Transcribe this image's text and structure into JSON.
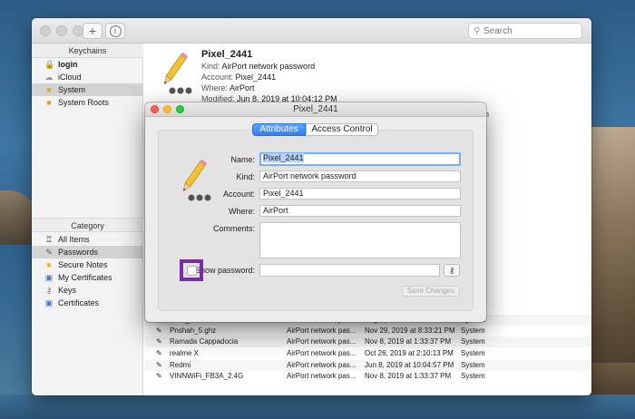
{
  "window": {
    "search_placeholder": "Search",
    "add_icon": "plus-icon",
    "info_icon": "info-icon"
  },
  "sidebar": {
    "keychains_header": "Keychains",
    "keychains": [
      {
        "label": "login",
        "icon": "lock-icon"
      },
      {
        "label": "iCloud",
        "icon": "cloud-icon"
      },
      {
        "label": "System",
        "icon": "folder-icon"
      },
      {
        "label": "System Roots",
        "icon": "folder-icon"
      }
    ],
    "category_header": "Category",
    "categories": [
      {
        "label": "All Items",
        "icon": "all-items-icon"
      },
      {
        "label": "Passwords",
        "icon": "pencil-icon"
      },
      {
        "label": "Secure Notes",
        "icon": "note-icon"
      },
      {
        "label": "My Certificates",
        "icon": "certificate-icon"
      },
      {
        "label": "Keys",
        "icon": "key-icon"
      },
      {
        "label": "Certificates",
        "icon": "certificate-icon"
      }
    ]
  },
  "detail": {
    "title": "Pixel_2441",
    "kind_label": "Kind:",
    "kind_value": "AirPort network password",
    "account_label": "Account:",
    "account_value": "Pixel_2441",
    "where_label": "Where:",
    "where_value": "AirPort",
    "modified_label": "Modified:",
    "modified_value": "Jun 8, 2019 at 10:04:12 PM"
  },
  "list": {
    "column_partial": "in",
    "rows": [
      {
        "name": "Pixel_8737",
        "kind": "AirPort network pas...",
        "date": "Aug 2, 2019 at 8:31:02 PM",
        "keychain": "System"
      },
      {
        "name": "Pnshah_5.ghz",
        "kind": "AirPort network pas...",
        "date": "Nov 29, 2019 at 8:33:21 PM",
        "keychain": "System"
      },
      {
        "name": "Ramada Cappadocia",
        "kind": "AirPort network pas...",
        "date": "Nov 8, 2019 at 1:33:37 PM",
        "keychain": "System"
      },
      {
        "name": "realme X",
        "kind": "AirPort network pas...",
        "date": "Oct 26, 2019 at 2:10:13 PM",
        "keychain": "System"
      },
      {
        "name": "Redmi",
        "kind": "AirPort network pas...",
        "date": "Jun 8, 2019 at 10:04:57 PM",
        "keychain": "System"
      },
      {
        "name": "VINNWiFi_FB3A_2.4G",
        "kind": "AirPort network pas...",
        "date": "Nov 8, 2019 at 1:33:37 PM",
        "keychain": "System"
      }
    ]
  },
  "popup": {
    "title": "Pixel_2441",
    "tabs": {
      "attributes": "Attributes",
      "access_control": "Access Control"
    },
    "name_label": "Name:",
    "name_value": "Pixel_2441",
    "kind_label": "Kind:",
    "kind_value": "AirPort network password",
    "account_label": "Account:",
    "account_value": "Pixel_2441",
    "where_label": "Where:",
    "where_value": "AirPort",
    "comments_label": "Comments:",
    "show_password_label": "Show password:",
    "show_password_checked": false,
    "save_label": "Save Changes",
    "highlight_color": "#7b2aa8"
  }
}
